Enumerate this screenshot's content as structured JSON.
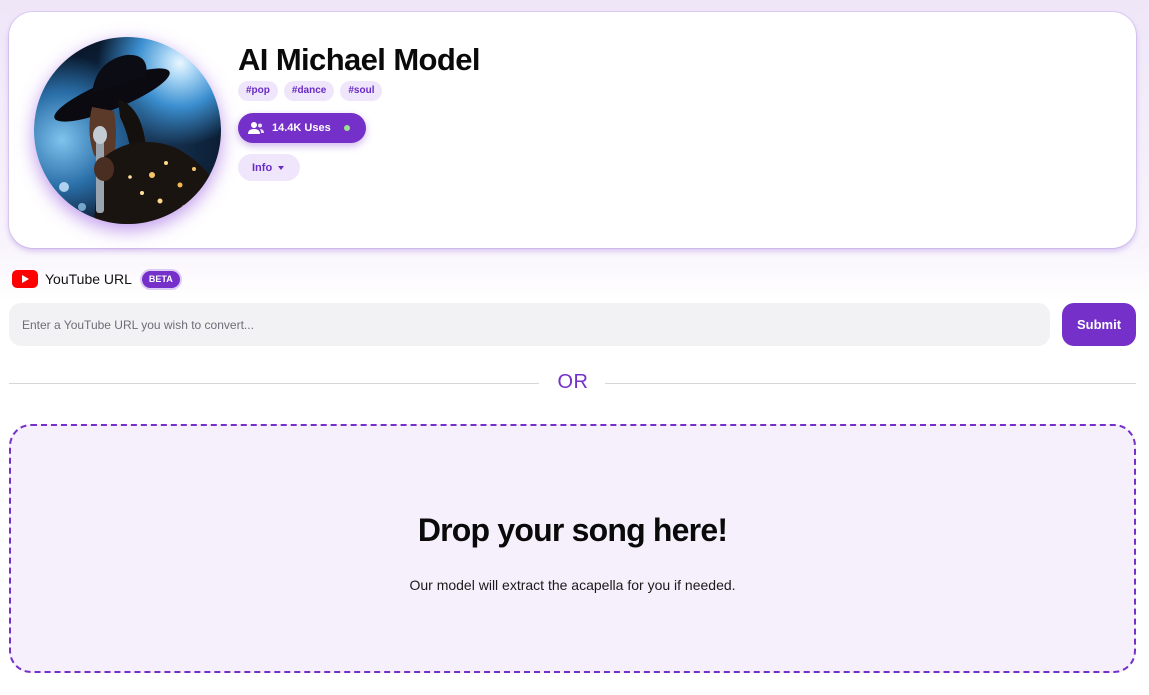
{
  "profile": {
    "title": "AI Michael Model",
    "tags": [
      "#pop",
      "#dance",
      "#soul"
    ],
    "uses_label": "14.4K Uses",
    "info_label": "Info"
  },
  "youtube": {
    "label": "YouTube URL",
    "badge": "BETA",
    "placeholder": "Enter a YouTube URL you wish to convert...",
    "submit_label": "Submit"
  },
  "divider": {
    "label": "OR"
  },
  "dropzone": {
    "title": "Drop your song here!",
    "subtitle": "Our model will extract the acapella for you if needed."
  },
  "colors": {
    "accent": "#7430c9",
    "accent_soft": "#efe6fb",
    "youtube_red": "#ff0000",
    "online": "#9be28f"
  },
  "icons": [
    "users-icon",
    "chevron-down-icon",
    "youtube-icon"
  ]
}
